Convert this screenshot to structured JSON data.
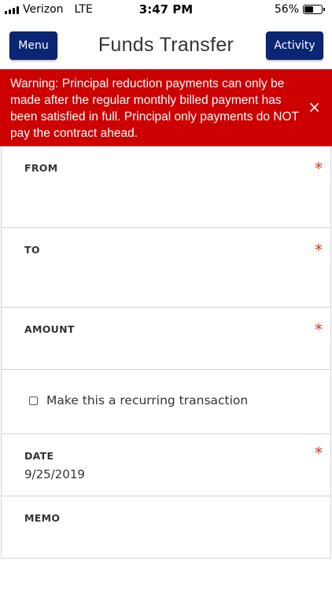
{
  "status_bar": {
    "carrier": "Verizon",
    "network": "LTE",
    "time": "3:47 PM",
    "battery_percent": "56%",
    "battery_level": 0.56
  },
  "header": {
    "menu_label": "Menu",
    "title": "Funds Transfer",
    "activity_label": "Activity"
  },
  "warning": {
    "text": "Warning: Principal reduction payments can only be made after the regular monthly billed payment has been satisfied in full. Principal only payments do NOT pay the contract ahead.",
    "close_icon": "×",
    "background_color": "#cc0000"
  },
  "form": {
    "from": {
      "label": "FROM",
      "required_mark": "*"
    },
    "to": {
      "label": "TO",
      "required_mark": "*"
    },
    "amount": {
      "label": "AMOUNT",
      "required_mark": "*"
    },
    "recurring": {
      "label": "Make this a recurring transaction",
      "checked": false
    },
    "date": {
      "label": "DATE",
      "required_mark": "*",
      "value": "9/25/2019"
    },
    "memo": {
      "label": "MEMO"
    }
  },
  "colors": {
    "primary_button": "#0b2675",
    "required_mark": "#d9341a"
  }
}
